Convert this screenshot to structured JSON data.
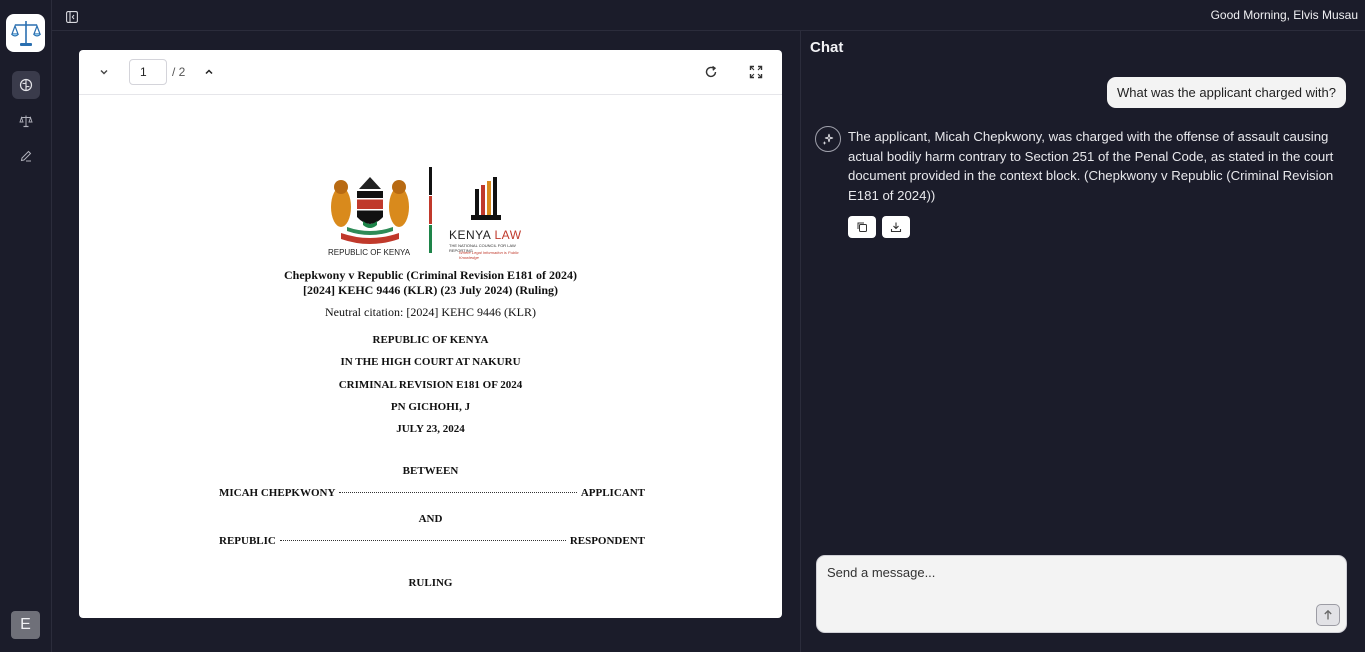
{
  "topbar": {
    "greeting": "Good Morning, Elvis Musau"
  },
  "sidebar": {
    "items": [
      {
        "id": "chat",
        "icon": "brain-icon",
        "active": true
      },
      {
        "id": "cases",
        "icon": "scales-icon",
        "active": false
      },
      {
        "id": "drafts",
        "icon": "pen-icon",
        "active": false
      }
    ],
    "avatar_initial": "E"
  },
  "viewer": {
    "page_current": "1",
    "page_total": "/ 2",
    "document": {
      "seal_caption": "REPUBLIC OF KENYA",
      "kenya_law_1": "KENYA",
      "kenya_law_2": "LAW",
      "kenya_law_sub": "THE NATIONAL COUNCIL FOR LAW REPORTING",
      "kenya_law_tag": "Where Legal Information is Public Knowledge",
      "title_line1": "Chepkwony v Republic (Criminal Revision E181 of 2024)",
      "title_line2": "[2024] KEHC 9446 (KLR) (23 July 2024) (Ruling)",
      "neutral_citation": "Neutral citation: [2024] KEHC 9446 (KLR)",
      "heading1": "REPUBLIC OF KENYA",
      "heading2": "IN THE HIGH COURT AT NAKURU",
      "heading3": "CRIMINAL REVISION E181 OF 2024",
      "heading4": "PN GICHOHI, J",
      "heading5": "JULY 23, 2024",
      "between": "BETWEEN",
      "party1_name": "MICAH CHEPKWONY",
      "party1_role": "APPLICANT",
      "and": "AND",
      "party2_name": "REPUBLIC",
      "party2_role": "RESPONDENT",
      "ruling": "RULING"
    }
  },
  "chat": {
    "title": "Chat",
    "messages": [
      {
        "role": "user",
        "text": "What was the applicant charged with?"
      },
      {
        "role": "assistant",
        "text": "The applicant, Micah Chepkwony, was charged with the offense of assault causing actual bodily harm contrary to Section 251 of the Penal Code, as stated in the court document provided in the context block. (Chepkwony v Republic (Criminal Revision E181 of 2024))"
      }
    ],
    "composer_placeholder": "Send a message..."
  },
  "colors": {
    "background": "#1b1c2a",
    "panel_border": "#2b2c3b",
    "viewer_bg": "#ffffff",
    "bubble_bg": "#f3f3f3"
  }
}
